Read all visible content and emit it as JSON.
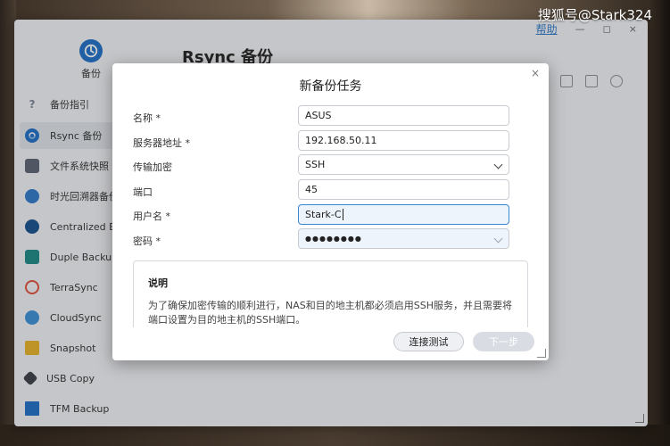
{
  "watermark": "搜狐号@Stark324",
  "window": {
    "help_link": "帮助",
    "minimize": "—",
    "maximize": "◻",
    "close": "×"
  },
  "app": {
    "name": "备份",
    "page_title": "Rsync 备份"
  },
  "sidebar": {
    "items": [
      {
        "label": "备份指引",
        "icon": "question-icon",
        "color": "#7b8496"
      },
      {
        "label": "Rsync 备份",
        "icon": "rsync-icon",
        "color": "#1e6fc7",
        "active": true
      },
      {
        "label": "文件系统快照",
        "icon": "snapshot-file-icon",
        "color": "#5b6372"
      },
      {
        "label": "时光回溯器备份",
        "icon": "time-machine-icon",
        "color": "#2f79c9"
      },
      {
        "label": "Centralized Backup",
        "icon": "centralized-icon",
        "color": "#14508f"
      },
      {
        "label": "Duple Backup",
        "icon": "duple-icon",
        "color": "#1a8a86"
      },
      {
        "label": "TerraSync",
        "icon": "terrasync-icon",
        "color": "#e0503c"
      },
      {
        "label": "CloudSync",
        "icon": "cloud-icon",
        "color": "#3a90d8"
      },
      {
        "label": "Snapshot",
        "icon": "folder-icon",
        "color": "#e8b22a"
      },
      {
        "label": "USB Copy",
        "icon": "usb-icon",
        "color": "#3a3f47"
      },
      {
        "label": "TFM Backup",
        "icon": "book-icon",
        "color": "#1e6fc7"
      }
    ]
  },
  "dialog": {
    "title": "新备份任务",
    "close": "×",
    "fields": {
      "name": {
        "label": "名称 *",
        "value": "ASUS"
      },
      "server": {
        "label": "服务器地址 *",
        "value": "192.168.50.11"
      },
      "encryption": {
        "label": "传输加密",
        "value": "SSH"
      },
      "port": {
        "label": "端口",
        "value": "45"
      },
      "username": {
        "label": "用户名 *",
        "value": "Stark-C"
      },
      "password": {
        "label": "密码 *",
        "value": "●●●●●●●●"
      }
    },
    "note": {
      "title": "说明",
      "text": "为了确保加密传输的顺利进行，NAS和目的地主机都必须启用SSH服务，并且需要将端口设置为目的地主机的SSH端口。"
    },
    "buttons": {
      "test": "连接测试",
      "next": "下一步"
    }
  }
}
